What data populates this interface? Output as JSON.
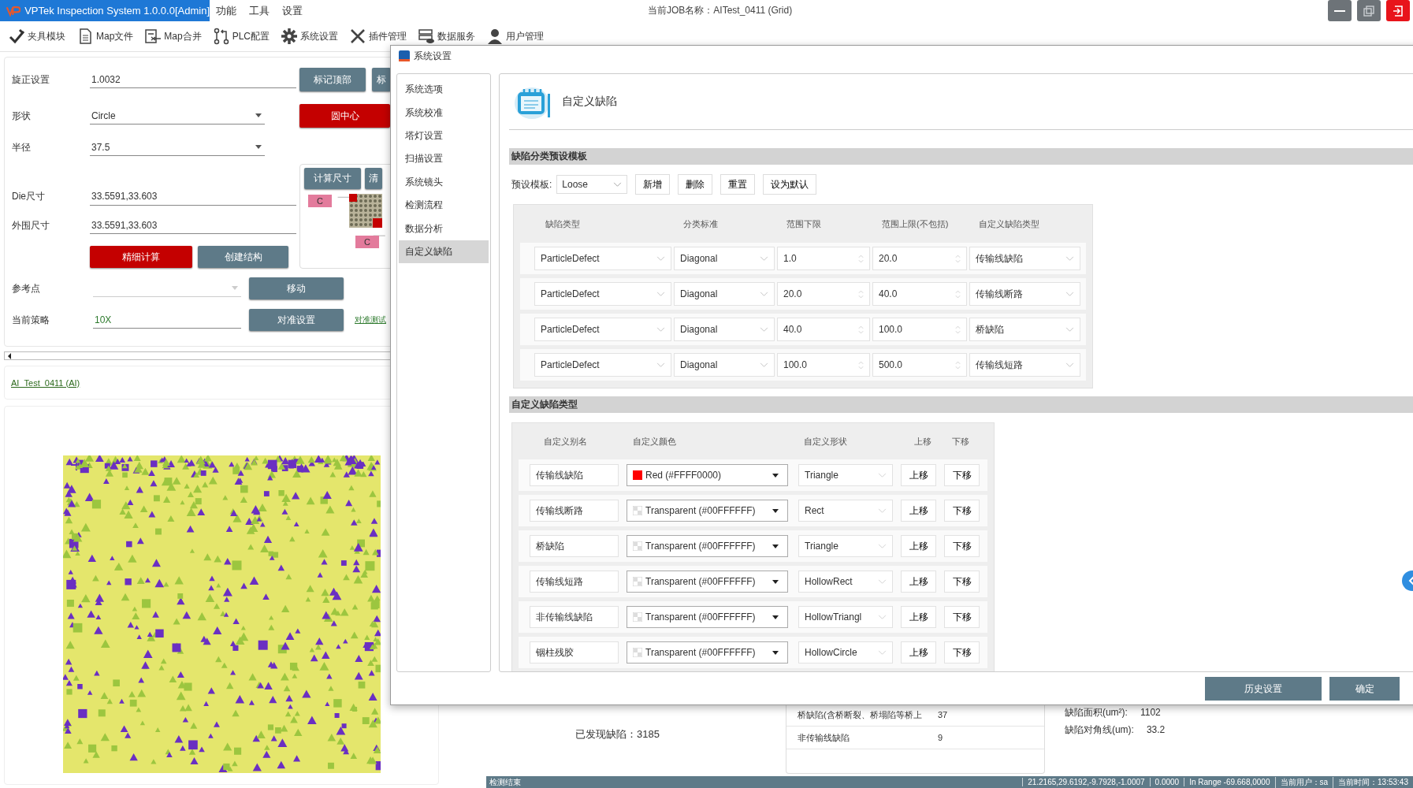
{
  "app": {
    "title": "VPTek Inspection System 1.0.0.0[Admin]",
    "menu": [
      "功能",
      "工具",
      "设置"
    ],
    "job": "当前JOB名称：AITest_0411 (Grid)"
  },
  "toolbar": [
    {
      "label": "夹具模块",
      "kind": "fixture"
    },
    {
      "label": "Map文件",
      "kind": "file"
    },
    {
      "label": "Map合并",
      "kind": "merge"
    },
    {
      "label": "PLC配置",
      "kind": "plc"
    },
    {
      "label": "系统设置",
      "kind": "gear"
    },
    {
      "label": "插件管理",
      "kind": "tools"
    },
    {
      "label": "数据服务",
      "kind": "server"
    },
    {
      "label": "用户管理",
      "kind": "user"
    }
  ],
  "left_panel": {
    "rotation": {
      "label": "旋正设置",
      "value": "1.0032"
    },
    "mark_top_button": "标记顶部",
    "partial_button": "标",
    "shape": {
      "label": "形状",
      "value": "Circle"
    },
    "center_button": "圆中心",
    "radius": {
      "label": "半径",
      "value": "37.5"
    },
    "structure": {
      "calc_button": "计算尺寸",
      "clear_button": "清",
      "nodes": [
        "C",
        "C"
      ]
    },
    "die_size": {
      "label": "Die尺寸",
      "value": "33.5591,33.603"
    },
    "outer_size": {
      "label": "外围尺寸",
      "value": "33.5591,33.603"
    },
    "fine_calc_button": "精细计算",
    "create_button": "创建结构",
    "reference": {
      "label": "参考点"
    },
    "move_button": "移动",
    "strategy": {
      "label": "当前策略",
      "value": "10X"
    },
    "align_button": "对准设置",
    "align_test_link": "对准测试",
    "job_link": "AI_Test_0411 (AI)"
  },
  "bottom_info": {
    "found": "已发现缺陷：3185",
    "stats": [
      {
        "name": "桥缺陷(含桥断裂、桥塌陷等桥上",
        "count": "37"
      },
      {
        "name": "非传输线缺陷",
        "count": "9"
      }
    ],
    "area": {
      "label": "缺陷面积(um²):",
      "value": "1102"
    },
    "diagonal": {
      "label": "缺陷对角线(um):",
      "value": "33.2"
    }
  },
  "status_bar": {
    "left": "检测结束",
    "segments": [
      "21.2165,29.6192,-9.7928,-1.0007",
      "0.0000",
      "In Range -69.668,0000",
      "当前用户：sa",
      "当前时间：13:53:43"
    ]
  },
  "dialog": {
    "title": "系统设置",
    "sidebar": [
      {
        "label": "系统选项",
        "selected": false
      },
      {
        "label": "系统校准",
        "selected": false
      },
      {
        "label": "塔灯设置",
        "selected": false
      },
      {
        "label": "扫描设置",
        "selected": false
      },
      {
        "label": "系统镜头",
        "selected": false
      },
      {
        "label": "检测流程",
        "selected": false
      },
      {
        "label": "数据分析",
        "selected": false
      },
      {
        "label": "自定义缺陷",
        "selected": true
      }
    ],
    "heading": "自定义缺陷",
    "preset_section": {
      "title": "缺陷分类预设模板",
      "preset_label": "预设模板:",
      "preset_value": "Loose",
      "buttons": [
        "新增",
        "删除",
        "重置",
        "设为默认"
      ],
      "columns": [
        "缺陷类型",
        "分类标准",
        "范围下限",
        "范围上限(不包括)",
        "自定义缺陷类型"
      ],
      "rows": [
        {
          "defect_type": "ParticleDefect",
          "standard": "Diagonal",
          "lower": "1.0",
          "upper": "20.0",
          "custom_type": "传输线缺陷"
        },
        {
          "defect_type": "ParticleDefect",
          "standard": "Diagonal",
          "lower": "20.0",
          "upper": "40.0",
          "custom_type": "传输线断路"
        },
        {
          "defect_type": "ParticleDefect",
          "standard": "Diagonal",
          "lower": "40.0",
          "upper": "100.0",
          "custom_type": "桥缺陷"
        },
        {
          "defect_type": "ParticleDefect",
          "standard": "Diagonal",
          "lower": "100.0",
          "upper": "500.0",
          "custom_type": "传输线短路"
        }
      ]
    },
    "custom_section": {
      "title": "自定义缺陷类型",
      "columns": [
        "自定义别名",
        "自定义颜色",
        "自定义形状",
        "上移",
        "下移"
      ],
      "rows": [
        {
          "alias": "传输线缺陷",
          "kind": "solid",
          "color": "#ff0000",
          "color_label": "Red (#FFFF0000)",
          "shape": "Triangle",
          "up": "上移",
          "down": "下移"
        },
        {
          "alias": "传输线断路",
          "kind": "transparent",
          "color_label": "Transparent (#00FFFFFF)",
          "shape": "Rect",
          "up": "上移",
          "down": "下移"
        },
        {
          "alias": "桥缺陷",
          "kind": "transparent",
          "color_label": "Transparent (#00FFFFFF)",
          "shape": "Triangle",
          "up": "上移",
          "down": "下移"
        },
        {
          "alias": "传输线短路",
          "kind": "transparent",
          "color_label": "Transparent (#00FFFFFF)",
          "shape": "HollowRect",
          "up": "上移",
          "down": "下移"
        },
        {
          "alias": "非传输线缺陷",
          "kind": "transparent",
          "color_label": "Transparent (#00FFFFFF)",
          "shape": "HollowTriangl",
          "up": "上移",
          "down": "下移"
        },
        {
          "alias": "铟柱残胶",
          "kind": "transparent",
          "color_label": "Transparent (#00FFFFFF)",
          "shape": "HollowCircle",
          "up": "上移",
          "down": "下移"
        }
      ]
    },
    "footer_buttons": [
      "历史设置",
      "确定"
    ]
  }
}
